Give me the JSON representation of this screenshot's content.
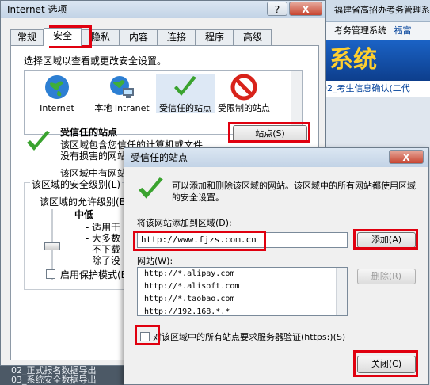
{
  "background": {
    "header_text": "福建省高招办考务管理系",
    "nav_text": "考务管理系统",
    "nav_link": "福富",
    "banner_text": "系统",
    "row_text": "02_考生信息确认(二代",
    "status_lines": [
      "02_正式报名数据导出",
      "03_系统安全数据导出"
    ]
  },
  "internet_options": {
    "title": "Internet 选项",
    "help_label": "?",
    "close_label": "X",
    "tabs": [
      "常规",
      "安全",
      "隐私",
      "内容",
      "连接",
      "程序",
      "高级"
    ],
    "zone_prompt": "选择区域以查看或更改安全设置。",
    "zones": [
      {
        "label": "Internet",
        "icon": "globe-icon"
      },
      {
        "label": "本地 Intranet",
        "icon": "intranet-icon"
      },
      {
        "label": "受信任的站点",
        "icon": "checkmark-icon"
      },
      {
        "label": "受限制的站点",
        "icon": "forbidden-icon"
      }
    ],
    "selected_zone_title": "受信任的站点",
    "selected_zone_desc": "该区域包含您信任的计算机或文件没有损害的网站。",
    "zone_has_sites": "该区域中有网站",
    "sites_button": "站点(S)",
    "security_level_group": "该区域的安全级别(L)",
    "allowed_levels": "该区域的允许级别(B):",
    "level_name": "中低",
    "level_bullets": [
      "- 适用于",
      "- 大多数",
      "- 不下载",
      "- 除了没"
    ],
    "protected_mode": "启用保护模式(B"
  },
  "trusted_sites": {
    "title": "受信任的站点",
    "close_label": "X",
    "info": "可以添加和删除该区域的网站。该区域中的所有网站都使用区域的安全设置。",
    "add_label": "将该网站添加到区域(D):",
    "add_value": "http://www.fjzs.com.cn",
    "add_button": "添加(A)",
    "sites_label": "网站(W):",
    "sites": [
      "http://*.alipay.com",
      "http://*.alisoft.com",
      "http://*.taobao.com",
      "http://192.168.*.*"
    ],
    "remove_button": "删除(R)",
    "require_https": "对该区域中的所有站点要求服务器验证(https:)(S)",
    "close_button": "关闭(C)"
  }
}
